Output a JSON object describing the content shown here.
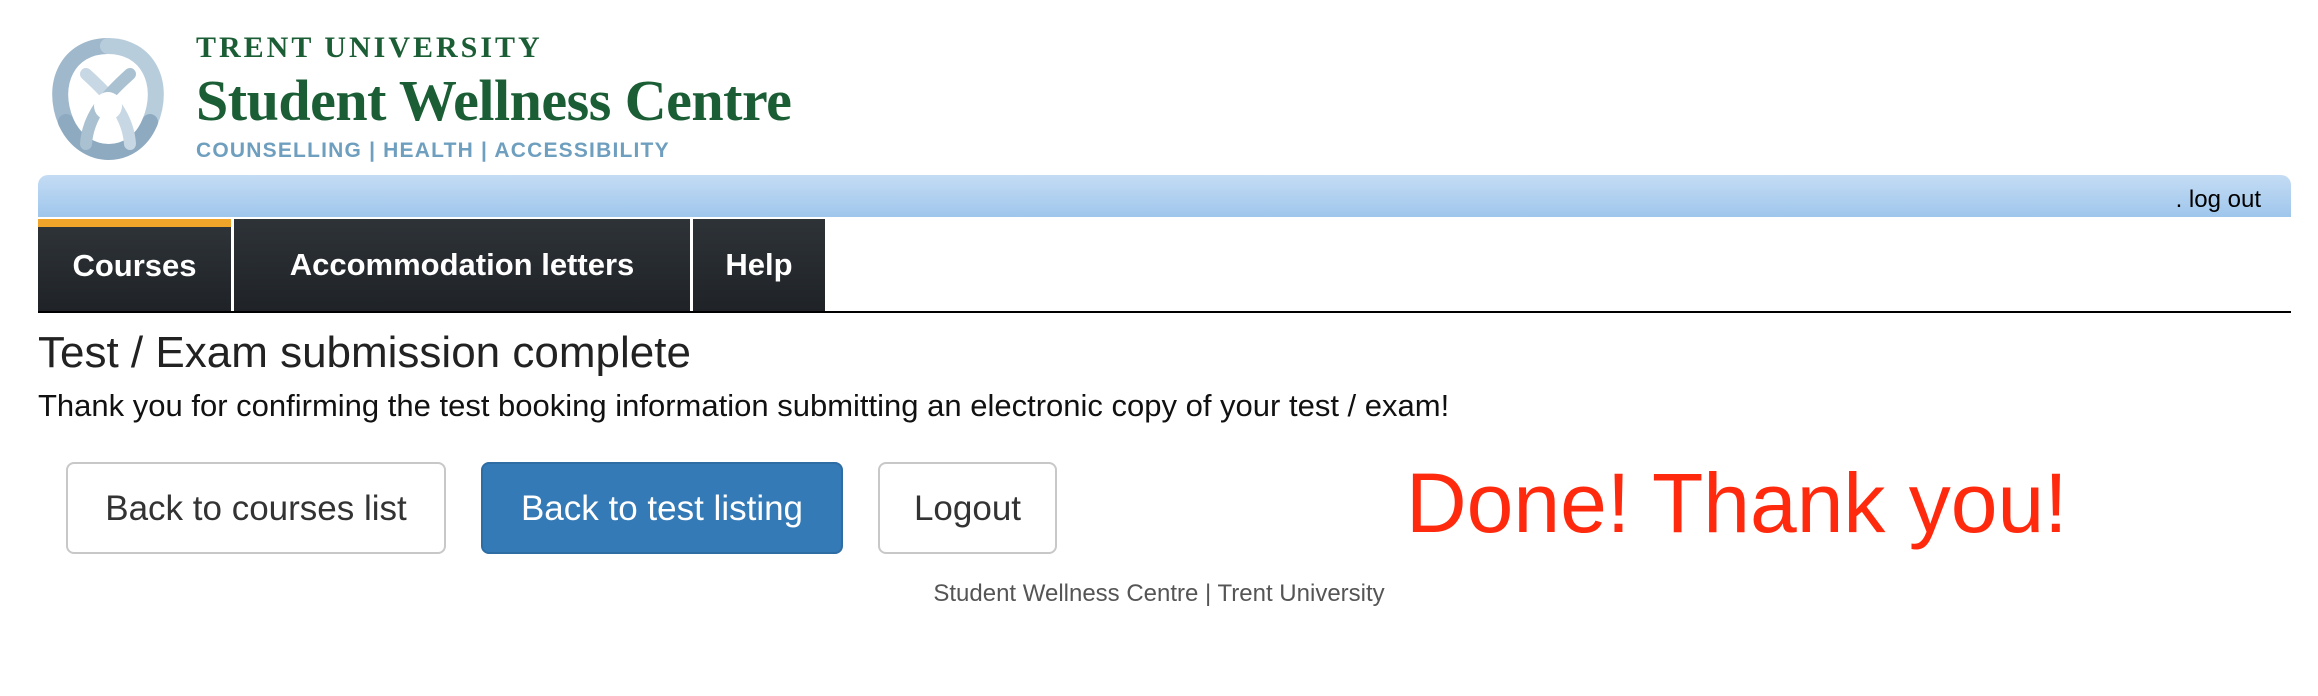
{
  "logo": {
    "university": "TRENT UNIVERSITY",
    "centre": "Student Wellness Centre",
    "tagline": "COUNSELLING | HEALTH | ACCESSIBILITY",
    "colors": {
      "primary": "#1b5e35",
      "tagline": "#6f9fbf",
      "mark": "#9fb8cc"
    }
  },
  "topbar": {
    "logout_label": ". log out"
  },
  "nav": {
    "tabs": [
      {
        "label": "Courses",
        "active": true
      },
      {
        "label": "Accommodation letters",
        "active": false
      },
      {
        "label": "Help",
        "active": false
      }
    ],
    "accent_color": "#f0a42a"
  },
  "content": {
    "title": "Test / Exam submission complete",
    "message": "Thank you for confirming the test booking information submitting an electronic copy of your test / exam!",
    "buttons": {
      "back_courses": "Back to courses list",
      "back_tests": "Back to test listing",
      "logout": "Logout"
    },
    "annotation": "Done! Thank you!",
    "annotation_color": "#ff2a0e"
  },
  "footer": {
    "text": "Student Wellness Centre | Trent University"
  }
}
